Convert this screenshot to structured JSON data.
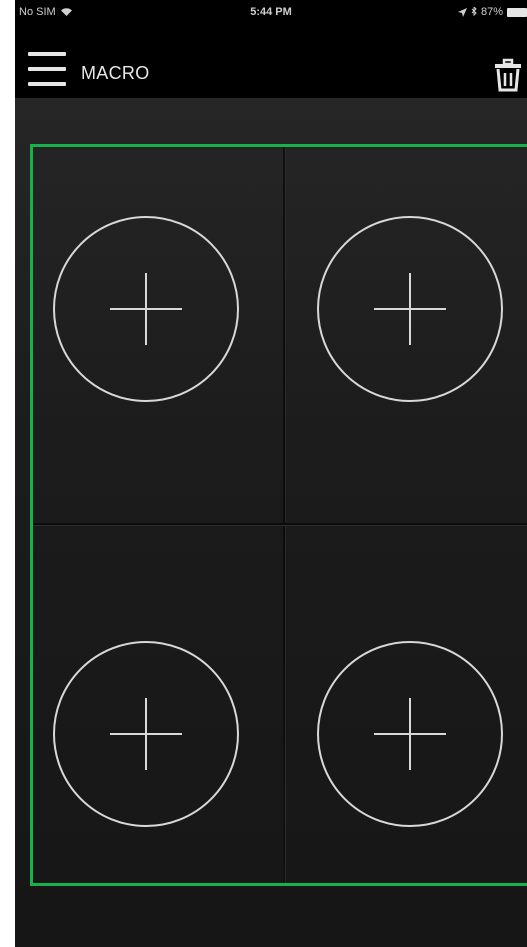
{
  "status_bar": {
    "carrier": "No SIM",
    "time": "5:44 PM",
    "battery_text": "87%"
  },
  "header": {
    "title": "MACRO",
    "menu_icon": "hamburger-menu-icon",
    "delete_icon": "trash-icon"
  },
  "macro_slots": [
    {
      "icon": "plus-icon"
    },
    {
      "icon": "plus-icon"
    },
    {
      "icon": "plus-icon"
    },
    {
      "icon": "plus-icon"
    }
  ],
  "colors": {
    "accent_border": "#17b24c",
    "background": "#1b1b1b",
    "bar": "#000000",
    "icon_stroke": "#d8d8d8"
  }
}
